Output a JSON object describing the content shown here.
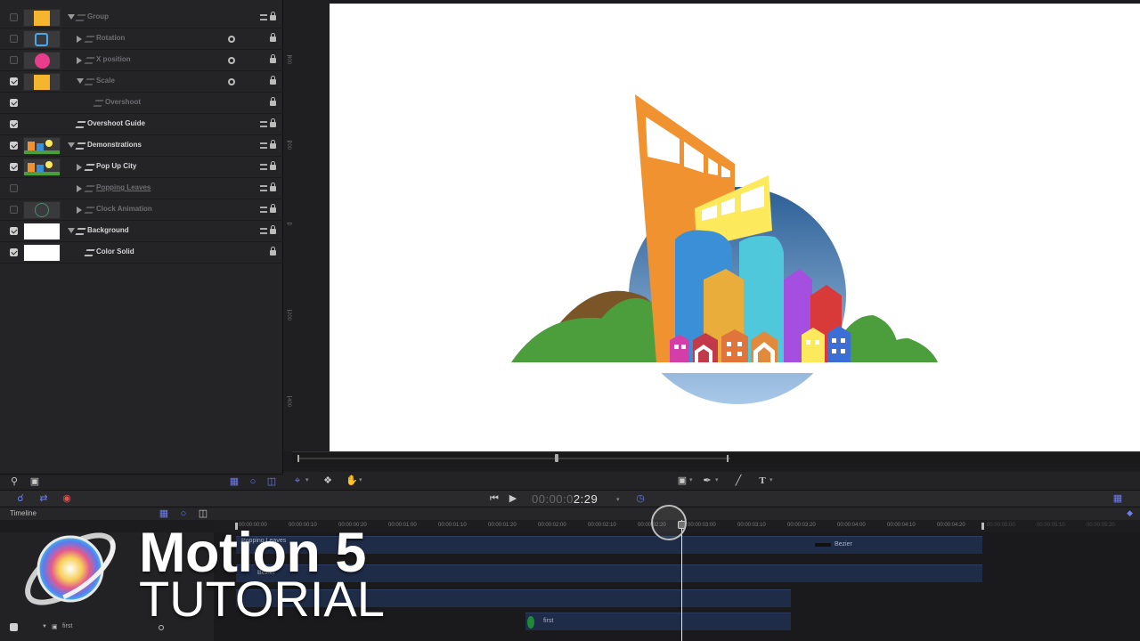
{
  "layers": [
    {
      "name": "Group",
      "checked": false,
      "dim": true,
      "underline": false,
      "indent": 0,
      "expanded": true,
      "thumb": "yellow-square",
      "gear": false,
      "stack": true
    },
    {
      "name": "Rotation",
      "checked": false,
      "dim": true,
      "underline": false,
      "indent": 1,
      "expanded": false,
      "thumb": "blue-square-outline",
      "gear": true,
      "stack": false
    },
    {
      "name": "X position",
      "checked": false,
      "dim": true,
      "underline": false,
      "indent": 1,
      "expanded": false,
      "thumb": "pink-circle",
      "gear": true,
      "stack": false
    },
    {
      "name": "Scale",
      "checked": true,
      "dim": true,
      "underline": false,
      "indent": 1,
      "expanded": true,
      "thumb": "yellow-square",
      "gear": true,
      "stack": false
    },
    {
      "name": "Overshoot",
      "checked": true,
      "dim": true,
      "underline": false,
      "indent": 2,
      "expanded": null,
      "thumb": "",
      "gear": false,
      "stack": false
    },
    {
      "name": "Overshoot Guide",
      "checked": true,
      "dim": false,
      "underline": false,
      "indent": 0,
      "expanded": null,
      "thumb": "",
      "gear": false,
      "stack": true
    },
    {
      "name": "Demonstrations",
      "checked": true,
      "dim": false,
      "underline": false,
      "indent": 0,
      "expanded": true,
      "thumb": "city",
      "gear": false,
      "stack": true
    },
    {
      "name": "Pop Up City",
      "checked": true,
      "dim": false,
      "underline": false,
      "indent": 1,
      "expanded": false,
      "thumb": "city",
      "gear": false,
      "stack": true
    },
    {
      "name": "Popping Leaves",
      "checked": false,
      "dim": true,
      "underline": true,
      "indent": 1,
      "expanded": false,
      "thumb": "",
      "gear": false,
      "stack": true
    },
    {
      "name": "Clock Animation",
      "checked": false,
      "dim": true,
      "underline": false,
      "indent": 1,
      "expanded": false,
      "thumb": "clock",
      "gear": false,
      "stack": true
    },
    {
      "name": "Background",
      "checked": true,
      "dim": false,
      "underline": false,
      "indent": 0,
      "expanded": true,
      "thumb": "white",
      "gear": false,
      "stack": true
    },
    {
      "name": "Color Solid",
      "checked": true,
      "dim": false,
      "underline": false,
      "indent": 1,
      "expanded": null,
      "thumb": "white",
      "gear": false,
      "stack": false
    }
  ],
  "ruler_labels": [
    "400",
    "200",
    "0",
    "-200",
    "-400"
  ],
  "transport": {
    "timecode_dim": "00:00:0",
    "timecode_main": "2:29"
  },
  "timeline": {
    "title": "Timeline",
    "timecodes": [
      "00:00:00:00",
      "00:00:00:10",
      "00:00:00:20",
      "00:00:01:00",
      "00:00:01:10",
      "00:00:01:20",
      "00:00:02:00",
      "00:00:02:10",
      "00:00:02:20",
      "00:00:03:00",
      "00:00:03:10",
      "00:00:03:20",
      "00:00:04:00",
      "00:00:04:10",
      "00:00:04:20",
      "00:00:05:00",
      "00:00:05:10",
      "00:00:05:20"
    ],
    "bars": [
      {
        "label": "Popping Leaves",
        "sub": "12"
      },
      {
        "label": "Bezier",
        "sub": ""
      },
      {
        "label": "",
        "sub": ""
      },
      {
        "label": "first",
        "sub": ""
      }
    ],
    "bezier_label": "Bezier",
    "left_row_label": "first"
  },
  "overlay": {
    "title": "Motion 5",
    "subtitle": "TUTORIAL"
  },
  "colors": {
    "orange": "#f0922f",
    "yellow": "#fde95c",
    "blue": "#3b8fd6",
    "cyan": "#4fc8dc",
    "purple": "#a44fe0",
    "red": "#d83a3a",
    "gold": "#e8ad3a",
    "green": "#4c9d3c",
    "brown": "#7a5528",
    "sky_top": "#2c5f96",
    "sky_bottom": "#a8c8e8"
  }
}
